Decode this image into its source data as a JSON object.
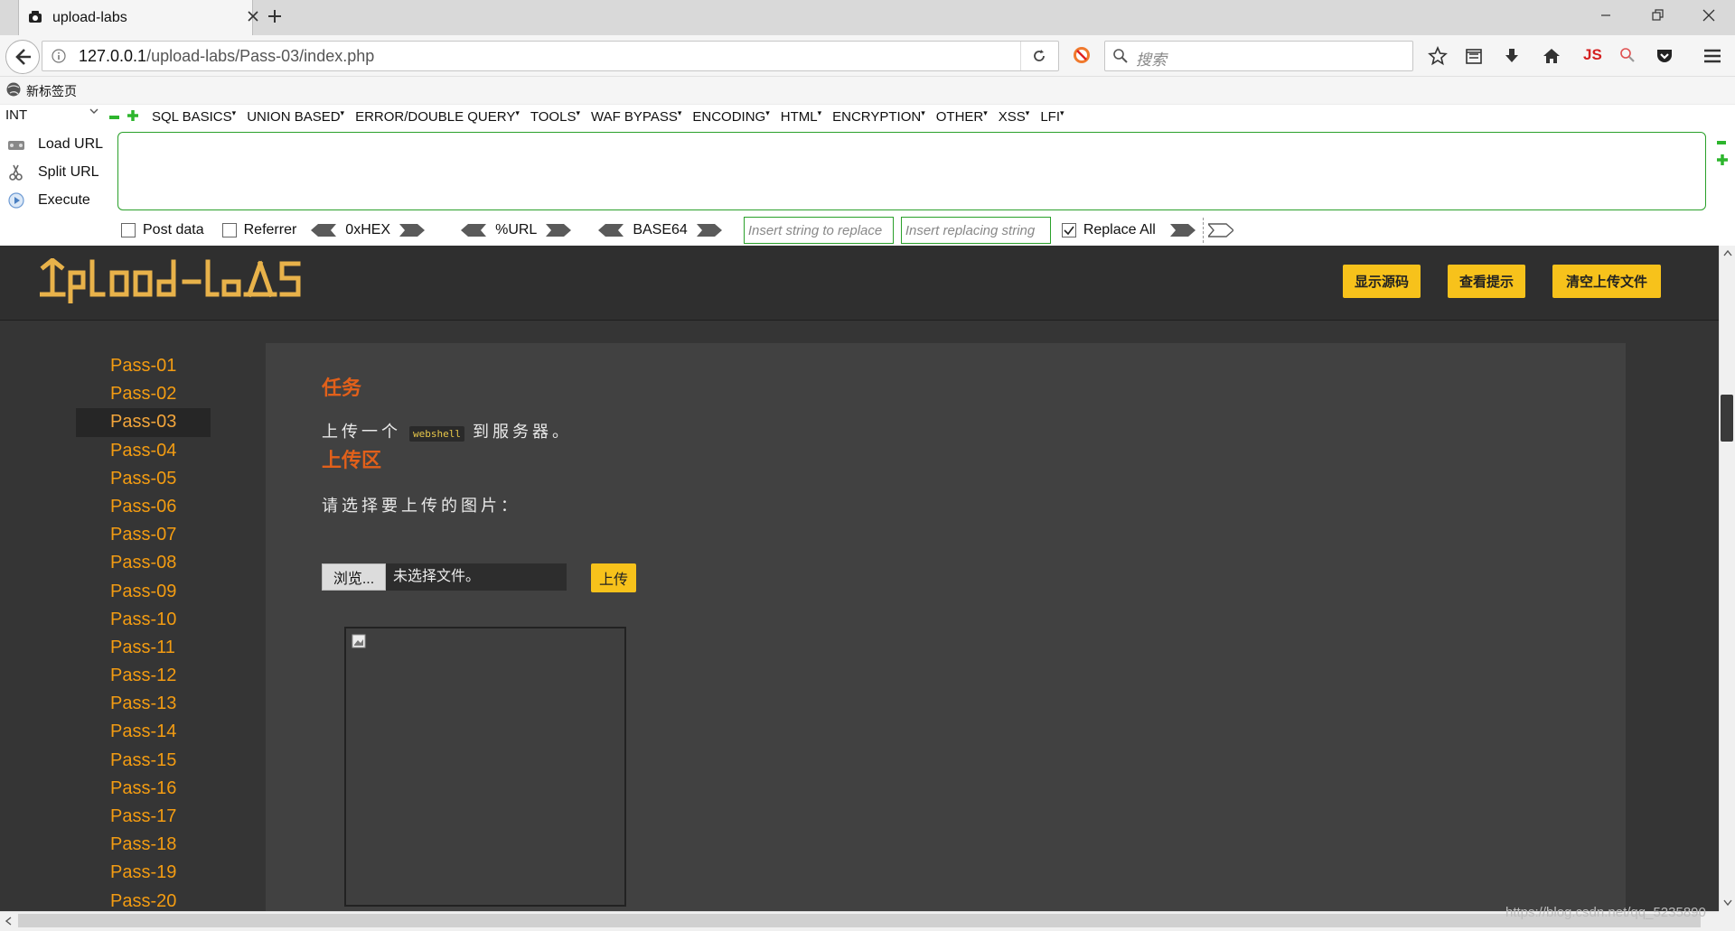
{
  "browser": {
    "tab_title": "upload-labs",
    "url_scheme_host": "127.0.0.1",
    "url_path": "/upload-labs/Pass-03/index.php",
    "search_placeholder": "搜索",
    "bookmark_label": "新标签页",
    "js_label": "JS"
  },
  "hackbar": {
    "select_value": "INT",
    "menu": [
      "SQL BASICS",
      "UNION BASED",
      "ERROR/DOUBLE QUERY",
      "TOOLS",
      "WAF BYPASS",
      "ENCODING",
      "HTML",
      "ENCRYPTION",
      "OTHER",
      "XSS",
      "LFI"
    ],
    "load_url": "Load URL",
    "split_url": "Split URL",
    "execute": "Execute",
    "url_value": "",
    "post_data": "Post data",
    "referrer": "Referrer",
    "hex": "0xHEX",
    "url_enc": "%URL",
    "base64": "BASE64",
    "replace_from_placeholder": "Insert string to replace",
    "replace_to_placeholder": "Insert replacing string",
    "replace_all": "Replace All",
    "replace_all_checked": true
  },
  "page": {
    "logo_text": "UpLoad-labs",
    "header_buttons": [
      "显示源码",
      "查看提示",
      "清空上传文件"
    ],
    "nav": [
      "Pass-01",
      "Pass-02",
      "Pass-03",
      "Pass-04",
      "Pass-05",
      "Pass-06",
      "Pass-07",
      "Pass-08",
      "Pass-09",
      "Pass-10",
      "Pass-11",
      "Pass-12",
      "Pass-13",
      "Pass-14",
      "Pass-15",
      "Pass-16",
      "Pass-17",
      "Pass-18",
      "Pass-19",
      "Pass-20"
    ],
    "active_nav": "Pass-03",
    "task_title": "任务",
    "task_before": "上传一个",
    "task_code": "webshell",
    "task_after": "到服务器。",
    "upload_title": "上传区",
    "upload_prompt": "请选择要上传的图片：",
    "browse_label": "浏览...",
    "file_status": "未选择文件。",
    "upload_button": "上传"
  },
  "watermark": "https://blog.csdn.net/qq_5235890",
  "colors": {
    "accent_yellow": "#f7c21b",
    "nav_orange": "#f39c12",
    "title_orange": "#e2601a",
    "page_bg": "#353535",
    "content_bg": "#414141"
  }
}
